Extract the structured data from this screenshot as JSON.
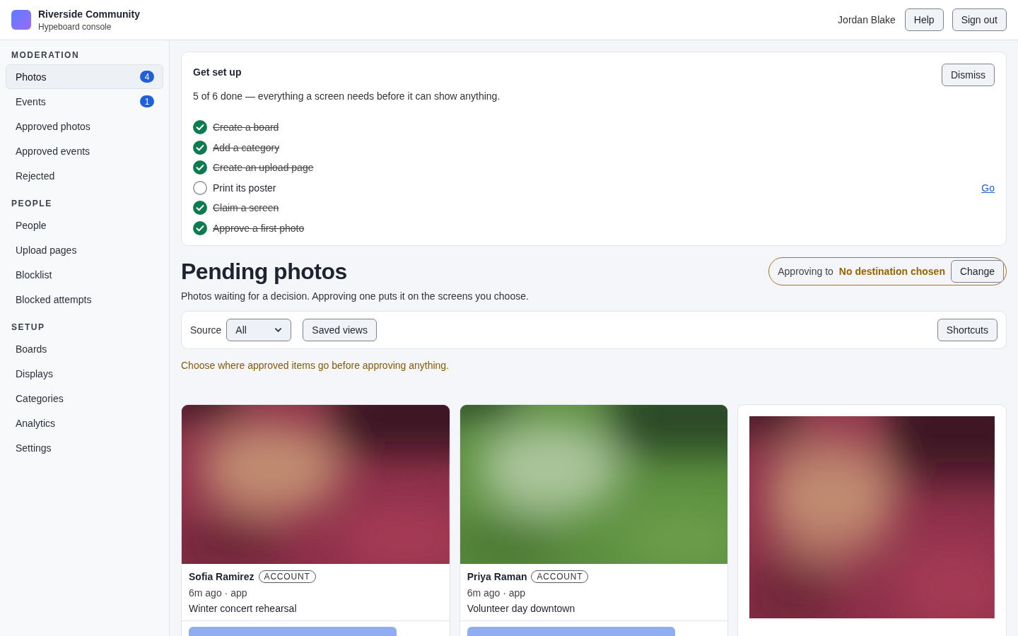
{
  "header": {
    "org": "Riverside Community",
    "subtitle": "Hypeboard console",
    "user": "Jordan Blake",
    "buttons": [
      "Help",
      "Sign out"
    ]
  },
  "sidebar": {
    "sections": [
      {
        "title": "MODERATION",
        "items": [
          {
            "label": "Photos",
            "badge": "4",
            "selected": true
          },
          {
            "label": "Events",
            "badge": "1",
            "selected": false
          },
          {
            "label": "Approved photos",
            "selected": false
          },
          {
            "label": "Approved events",
            "selected": false
          },
          {
            "label": "Rejected",
            "selected": false
          }
        ]
      },
      {
        "title": "PEOPLE",
        "items": [
          {
            "label": "People",
            "selected": false
          },
          {
            "label": "Upload pages",
            "selected": false
          },
          {
            "label": "Blocklist",
            "selected": false
          },
          {
            "label": "Blocked attempts",
            "selected": false
          }
        ]
      },
      {
        "title": "SETUP",
        "items": [
          {
            "label": "Boards",
            "selected": false
          },
          {
            "label": "Displays",
            "selected": false
          },
          {
            "label": "Categories",
            "selected": false
          },
          {
            "label": "Analytics",
            "selected": false
          },
          {
            "label": "Settings",
            "selected": false
          }
        ]
      }
    ]
  },
  "setup": {
    "title": "Get set up",
    "summary": "5 of 6 done — everything a screen needs before it can show anything.",
    "dismiss": "Dismiss",
    "steps": [
      {
        "label": "Create a board",
        "checked": true
      },
      {
        "label": "Add a category",
        "checked": true
      },
      {
        "label": "Create an upload page",
        "checked": true
      },
      {
        "label": "Print its poster",
        "checked": false,
        "link": "Go"
      },
      {
        "label": "Claim a screen",
        "checked": true
      },
      {
        "label": "Approve a first photo",
        "checked": true
      }
    ]
  },
  "page": {
    "title": "Pending photos",
    "description": "Photos waiting for a decision. Approving one puts it on the screens you choose.",
    "destination": {
      "label": "Approving to",
      "value": "No destination chosen",
      "button": "Change"
    }
  },
  "toolbar": {
    "source_label": "Source",
    "source_value": "All",
    "saved_views": "Saved views",
    "shortcuts": "Shortcuts"
  },
  "warning": "Choose where approved items go before approving anything.",
  "cards": [
    {
      "kind": "compact",
      "name": "Sofia Ramirez",
      "tag": "ACCOUNT",
      "meta": "6m ago · app",
      "caption": "Winter concert rehearsal"
    },
    {
      "kind": "compact",
      "name": "Priya Raman",
      "tag": "ACCOUNT",
      "meta": "6m ago · app",
      "caption": "Volunteer day downtown"
    },
    {
      "kind": "large"
    }
  ]
}
